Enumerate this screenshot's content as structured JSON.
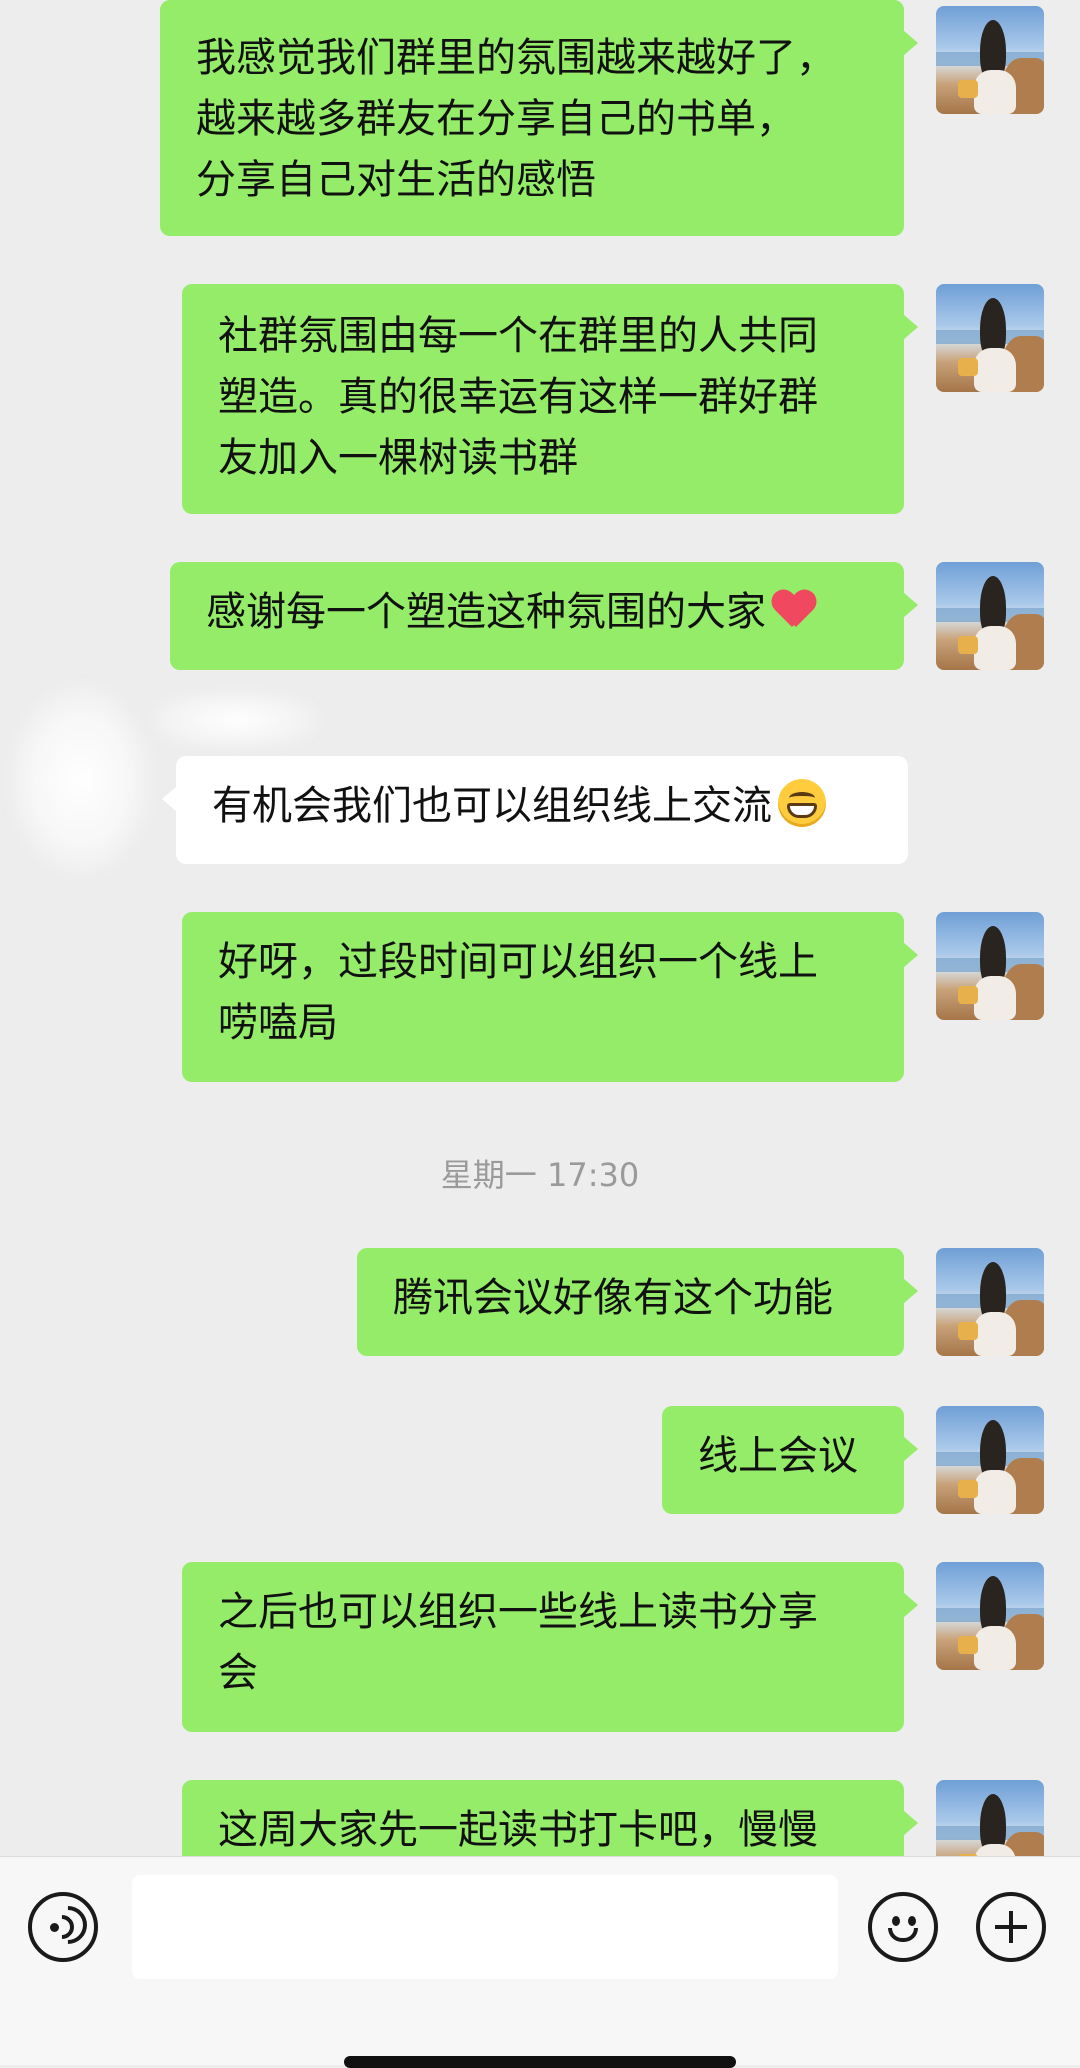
{
  "messages": [
    {
      "side": "out",
      "text": "我感觉我们群里的氛围越来越好了，\n越来越多群友在分享自己的书单，\n分享自己对生活的感悟"
    },
    {
      "side": "out",
      "text": "社群氛围由每一个在群里的人共同\n塑造。真的很幸运有这样一群好群\n友加入一棵树读书群"
    },
    {
      "side": "out",
      "text": "感谢每一个塑造这种氛围的大家",
      "emoji": "heart-emoji"
    },
    {
      "side": "in",
      "text": "有机会我们也可以组织线上交流",
      "emoji": "grin-emoji"
    },
    {
      "side": "out",
      "text": "好呀，过段时间可以组织一个线上\n唠嗑局"
    },
    {
      "side": "out",
      "text": "腾讯会议好像有这个功能"
    },
    {
      "side": "out",
      "text": "线上会议"
    },
    {
      "side": "out",
      "text": "之后也可以组织一些线上读书分享\n会"
    },
    {
      "side": "out",
      "text": "这周大家先一起读书打卡吧，慢慢"
    }
  ],
  "timestamp": "星期一 17:30",
  "input_bar": {
    "voice_icon": "voice-icon",
    "emoji_icon": "emoji-face-icon",
    "plus_icon": "plus-icon",
    "input_value": ""
  },
  "colors": {
    "background": "#ededed",
    "outgoing_bubble": "#95ec69",
    "incoming_bubble": "#ffffff",
    "timestamp_text": "#9a9a9a"
  }
}
